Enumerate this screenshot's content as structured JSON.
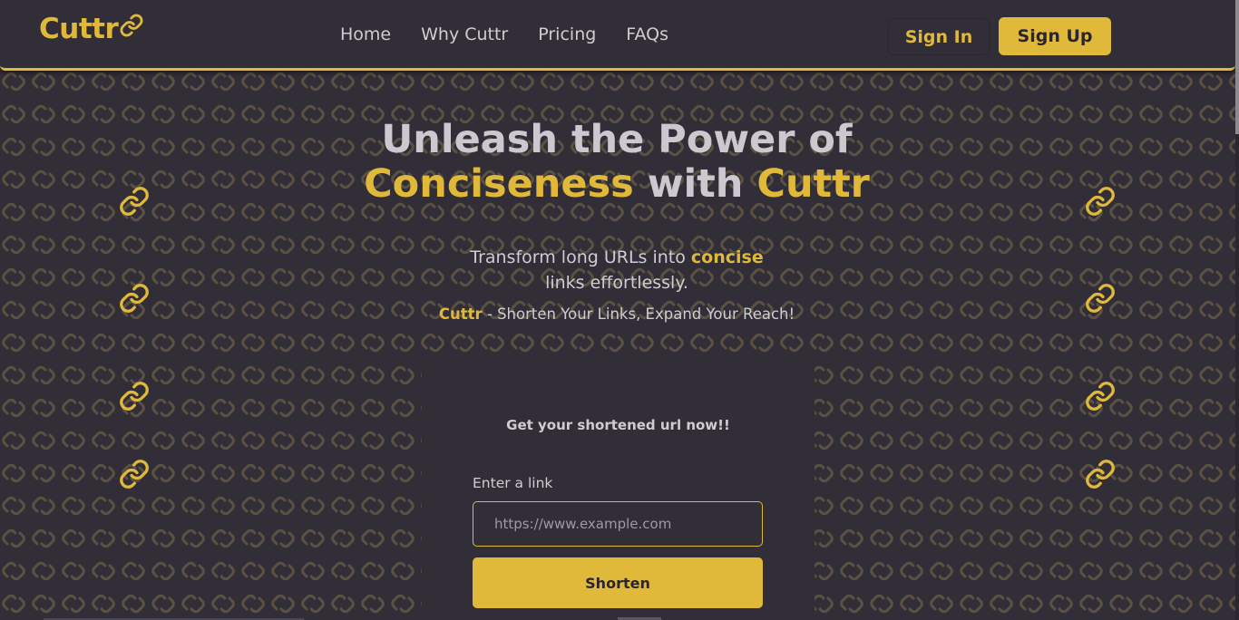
{
  "colors": {
    "background": "#322e38",
    "accent": "#e0b93a",
    "text": "#cfccd2",
    "pattern": "#5a5142"
  },
  "navbar": {
    "logo": "Cuttr",
    "logo_icon": "link-icon",
    "links": [
      "Home",
      "Why Cuttr",
      "Pricing",
      "FAQs"
    ],
    "sign_in": "Sign In",
    "sign_up": "Sign Up"
  },
  "hero": {
    "title_line1": "Unleash the Power of",
    "title_word_conciseness": "Conciseness",
    "title_word_with": "with",
    "title_word_cuttr": "Cuttr",
    "sub_before": "Transform long URLs into",
    "sub_highlight": "concise",
    "sub_after": "links effortlessly.",
    "tagline_brand": "Cuttr",
    "tagline_rest": " - Shorten Your Links, Expand Your Reach!",
    "decor_icon": "link-icon"
  },
  "form": {
    "title": "Get your shortened url now!!",
    "label": "Enter a link",
    "placeholder": "https://www.example.com",
    "button": "Shorten"
  }
}
